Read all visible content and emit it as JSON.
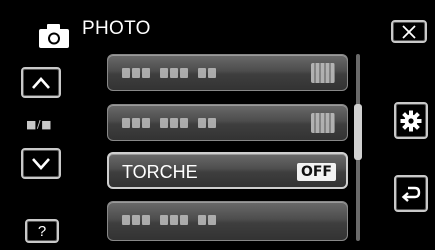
{
  "header": {
    "title": "PHOTO",
    "icon": "camera-icon"
  },
  "nav": {
    "toggle_label": "■/■",
    "up_icon": "chevron-up-icon",
    "down_icon": "chevron-down-icon",
    "help_label": "?"
  },
  "menu": {
    "items": [
      {
        "label": "",
        "value": ""
      },
      {
        "label": "",
        "value": ""
      },
      {
        "label": "TORCHE",
        "value": "OFF"
      },
      {
        "label": "",
        "value": ""
      }
    ]
  },
  "right_buttons": [
    "close-icon",
    "gear-icon",
    "back-icon"
  ],
  "scroll": {
    "position_fraction": 0.3
  }
}
